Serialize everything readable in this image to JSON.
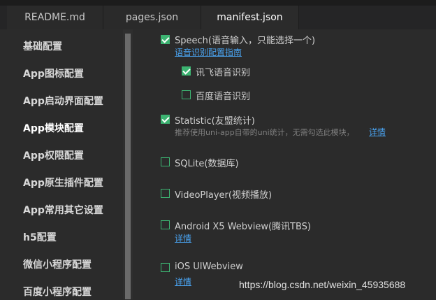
{
  "tabs": [
    {
      "label": "README.md"
    },
    {
      "label": "pages.json"
    },
    {
      "label": "manifest.json"
    }
  ],
  "sidebar": {
    "items": [
      {
        "label": "基础配置"
      },
      {
        "label": "App图标配置"
      },
      {
        "label": "App启动界面配置"
      },
      {
        "label": "App模块配置"
      },
      {
        "label": "App权限配置"
      },
      {
        "label": "App原生插件配置"
      },
      {
        "label": "App常用其它设置"
      },
      {
        "label": "h5配置"
      },
      {
        "label": "微信小程序配置"
      },
      {
        "label": "百度小程序配置"
      }
    ],
    "active_index": 3
  },
  "modules": {
    "speech": {
      "label": "Speech(语音输入，只能选择一个)",
      "checked": true,
      "link": "语音识别配置指南"
    },
    "xunfei": {
      "label": "讯飞语音识别",
      "checked": true
    },
    "baidu": {
      "label": "百度语音识别",
      "checked": false
    },
    "statistic": {
      "label": "Statistic(友盟统计)",
      "checked": true,
      "desc": "推荐使用uni-app自带的uni统计，无需勾选此模块，",
      "link": "详情"
    },
    "sqlite": {
      "label": "SQLite(数据库)",
      "checked": false
    },
    "videoplayer": {
      "label": "VideoPlayer(视频播放)",
      "checked": false
    },
    "x5": {
      "label": "Android X5 Webview(腾讯TBS)",
      "checked": false,
      "link": "详情"
    },
    "uiwebview": {
      "label": "iOS UIWebview",
      "checked": false,
      "link": "详情"
    }
  },
  "watermark": "https://blog.csdn.net/weixin_45935688",
  "colors": {
    "checkbox": "#3cb371",
    "link": "#4aa3f0",
    "background": "#2b2b2b"
  }
}
